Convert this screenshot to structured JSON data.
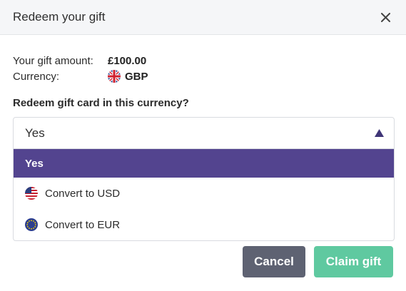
{
  "modal": {
    "title": "Redeem your gift"
  },
  "gift": {
    "amount_label": "Your gift amount:",
    "amount_value": "£100.00",
    "currency_label": "Currency:",
    "currency_value": "GBP",
    "currency_flag_icon": "uk-flag-icon"
  },
  "form": {
    "question": "Redeem gift card in this currency?",
    "selected_value": "Yes",
    "options": [
      {
        "label": "Yes",
        "selected": true
      },
      {
        "label": "Convert to USD",
        "icon": "us-flag-icon"
      },
      {
        "label": "Convert to EUR",
        "icon": "eu-flag-icon"
      }
    ]
  },
  "actions": {
    "cancel_label": "Cancel",
    "claim_label": "Claim gift"
  },
  "colors": {
    "selected_option_bg": "#53448f",
    "cancel_bg": "#5e6272",
    "claim_bg": "#5fc9a0",
    "header_bg": "#f5f6f8"
  }
}
